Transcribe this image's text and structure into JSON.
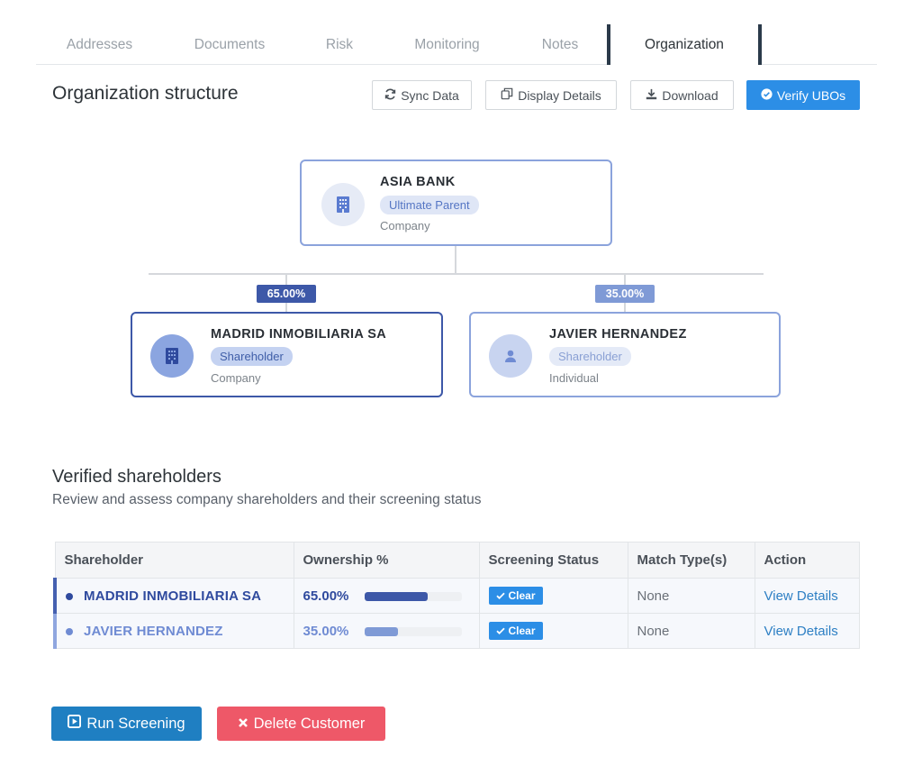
{
  "tabs": [
    {
      "label": "Addresses"
    },
    {
      "label": "Documents"
    },
    {
      "label": "Risk"
    },
    {
      "label": "Monitoring"
    },
    {
      "label": "Notes"
    },
    {
      "label": "Organization",
      "active": true
    }
  ],
  "header": {
    "title": "Organization structure",
    "sync_label": "Sync Data",
    "display_label": "Display Details",
    "download_label": "Download",
    "verify_label": "Verify UBOs"
  },
  "org": {
    "root": {
      "name": "ASIA BANK",
      "role": "Ultimate Parent",
      "kind": "Company",
      "icon": "building-icon"
    },
    "children": [
      {
        "name": "MADRID INMOBILIARIA SA",
        "role": "Shareholder",
        "kind": "Company",
        "percent": "65.00%",
        "icon": "building-icon"
      },
      {
        "name": "JAVIER HERNANDEZ",
        "role": "Shareholder",
        "kind": "Individual",
        "percent": "35.00%",
        "icon": "person-icon"
      }
    ]
  },
  "shareholders": {
    "title": "Verified shareholders",
    "subtitle": "Review and assess company shareholders and their screening status",
    "columns": [
      "Shareholder",
      "Ownership %",
      "Screening Status",
      "Match Type(s)",
      "Action"
    ],
    "rows": [
      {
        "name": "MADRID INMOBILIARIA SA",
        "ownership": "65.00%",
        "ownership_value": 65,
        "status": "Clear",
        "match": "None",
        "action": "View Details",
        "color": "#2f4a9e"
      },
      {
        "name": "JAVIER HERNANDEZ",
        "ownership": "35.00%",
        "ownership_value": 35,
        "status": "Clear",
        "match": "None",
        "action": "View Details",
        "color": "#6f8bd3"
      }
    ]
  },
  "actions": {
    "run_label": "Run Screening",
    "delete_label": "Delete Customer"
  },
  "colors": {
    "primary": "#2c8ee6",
    "run_button": "#1f7fc2",
    "delete_button": "#ee5868",
    "dark_badge": "#3d58a8",
    "light_badge": "#7f9ad6"
  }
}
